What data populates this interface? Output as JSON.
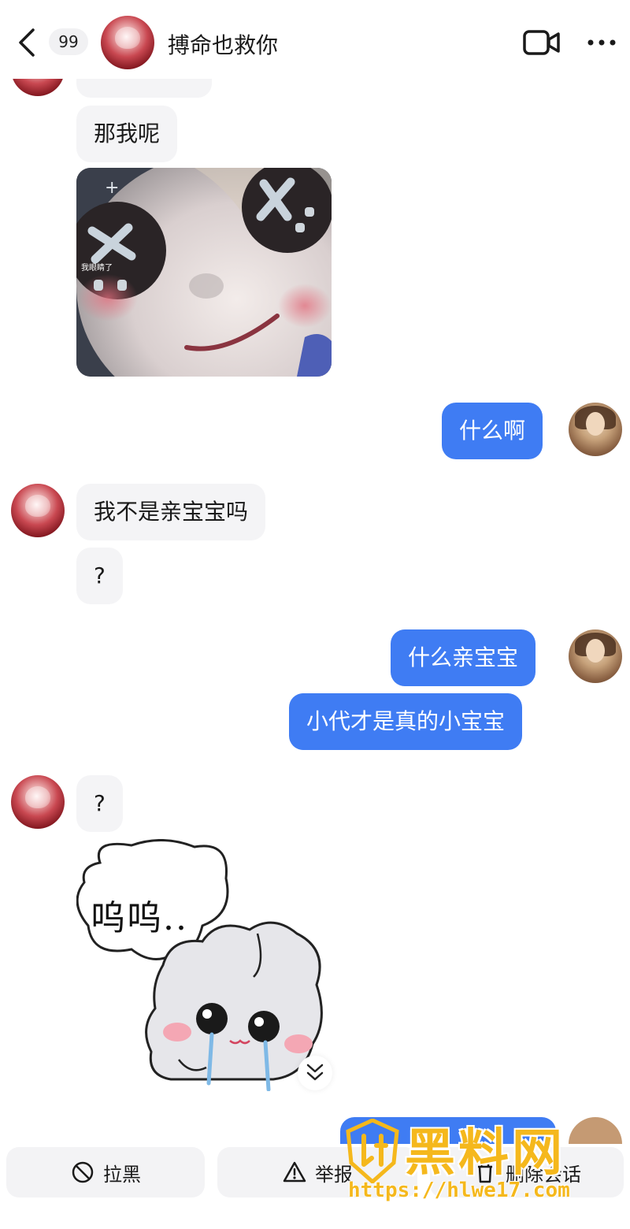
{
  "header": {
    "unread_count": "99",
    "contact_name": "搏命也救你",
    "icons": {
      "back": "back-arrow-icon",
      "video": "video-call-icon",
      "more": "more-dots-icon"
    }
  },
  "messages": [
    {
      "side": "in",
      "type": "text",
      "text": "那我呢"
    },
    {
      "side": "in",
      "type": "sticker",
      "sticker": "doll-face-sticker",
      "caption": "我眼睛了"
    },
    {
      "side": "out",
      "type": "text",
      "text": "什么啊"
    },
    {
      "side": "in",
      "type": "text",
      "text": "我不是亲宝宝吗"
    },
    {
      "side": "in",
      "type": "text",
      "text": "?"
    },
    {
      "side": "out",
      "type": "text",
      "text": "什么亲宝宝"
    },
    {
      "side": "out",
      "type": "text",
      "text": "小代才是真的小宝宝"
    },
    {
      "side": "in",
      "type": "text",
      "text": "?"
    },
    {
      "side": "in",
      "type": "sticker",
      "sticker": "crying-bunny-sticker",
      "caption": "呜呜.."
    }
  ],
  "actions": {
    "block_label": "拉黑",
    "report_label": "举报",
    "delete_label": "删除会话"
  },
  "watermark": {
    "title": "黑料网",
    "url": "https://hlwe17.com"
  },
  "colors": {
    "outgoing_bubble": "#3f7cf3",
    "incoming_bubble": "#f4f4f6",
    "watermark": "#f5b81c"
  }
}
